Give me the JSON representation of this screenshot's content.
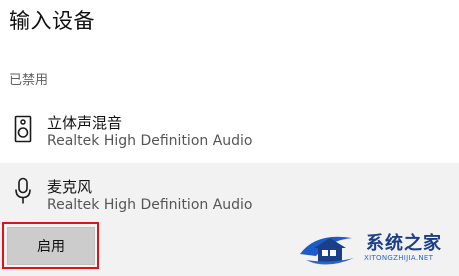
{
  "section": {
    "title": "输入设备"
  },
  "disabled_group": {
    "label": "已禁用"
  },
  "devices": [
    {
      "name": "立体声混音",
      "description": "Realtek High Definition Audio",
      "icon": "speaker-icon"
    },
    {
      "name": "麦克风",
      "description": "Realtek High Definition Audio",
      "icon": "microphone-icon",
      "selected": true
    }
  ],
  "enable_button": {
    "label": "启用"
  },
  "watermark": {
    "text": "系统之家",
    "url": "XITONGZHIJIA.NET"
  },
  "colors": {
    "highlight_border": "#d8141c",
    "selected_row_bg": "#f2f2f2",
    "button_bg": "#cccccc",
    "watermark_blue": "#1a3f88"
  }
}
